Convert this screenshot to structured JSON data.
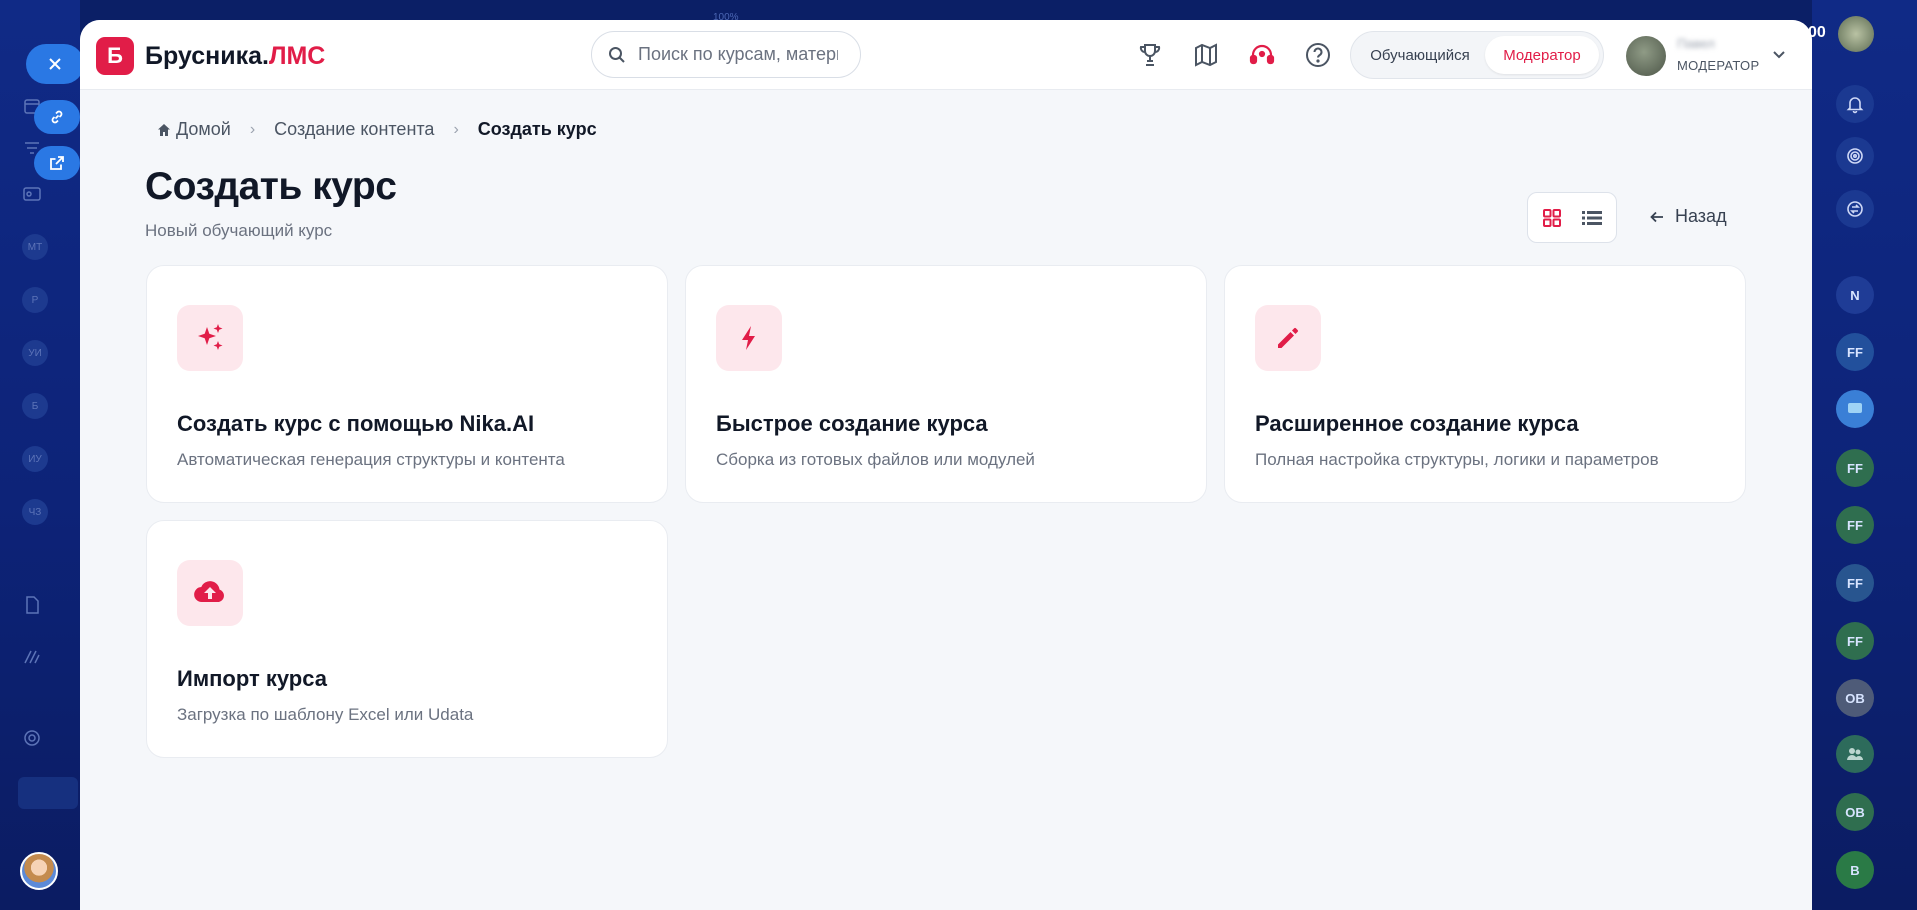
{
  "brand": {
    "mark": "Б",
    "name": "Брусника.",
    "accent": "ЛМС",
    "accent_color": "#e11d48"
  },
  "search": {
    "placeholder": "Поиск по курсам, материалам"
  },
  "header_icons": [
    "trophy-icon",
    "map-icon",
    "support-icon",
    "help-icon"
  ],
  "role_switch": {
    "learner": "Обучающийся",
    "moderator": "Модератор",
    "active": "moderator"
  },
  "user": {
    "name": "Павел",
    "role": "МОДЕРАТОР"
  },
  "breadcrumb": [
    {
      "label": "Домой"
    },
    {
      "label": "Создание контента"
    },
    {
      "label": "Создать курс"
    }
  ],
  "page": {
    "title": "Создать курс",
    "subtitle": "Новый обучающий курс"
  },
  "view": {
    "active": "grid"
  },
  "back": {
    "label": "Назад"
  },
  "cards": [
    {
      "icon": "sparkles-icon",
      "title": "Создать курс с помощью Nika.AI",
      "desc": "Автоматическая генерация структуры и контента"
    },
    {
      "icon": "lightning-icon",
      "title": "Быстрое создание курса",
      "desc": "Сборка из готовых файлов или модулей"
    },
    {
      "icon": "pencil-icon",
      "title": "Расширенное создание курса",
      "desc": "Полная настройка структуры, логики и параметров"
    },
    {
      "icon": "cloud-upload-icon",
      "title": "Импорт курса",
      "desc": "Загрузка по шаблону Excel или Udata"
    }
  ],
  "background": {
    "left_badges": [
      "МТ",
      "Р",
      "УИ",
      "Б",
      "ИУ",
      "ЧЗ"
    ],
    "right_avatars": [
      "N",
      "FF",
      "FF",
      "FF",
      "FF",
      "FF",
      "OB",
      "B"
    ],
    "top_value": "00",
    "top_zoom": "100%"
  }
}
